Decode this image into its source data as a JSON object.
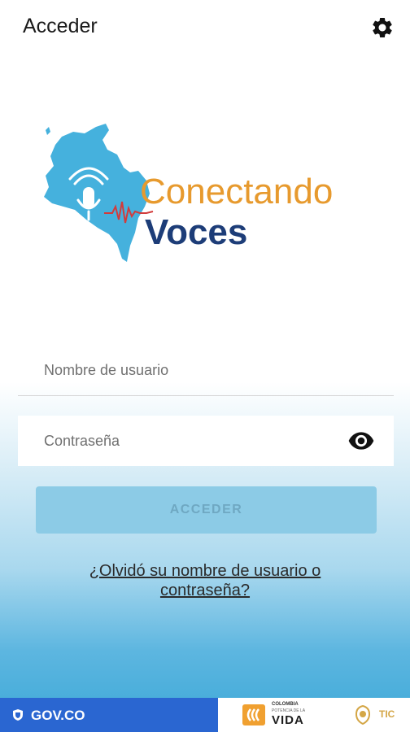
{
  "header": {
    "title": "Acceder",
    "settings_icon": "gear-icon"
  },
  "logo": {
    "line1": "Conectando",
    "line2": "Voces",
    "color_primary": "#e79a2e",
    "color_secondary": "#1d3d78",
    "map_color": "#45b1dd"
  },
  "form": {
    "username_placeholder": "Nombre de usuario",
    "password_placeholder": "Contraseña",
    "show_password_icon": "eye-icon",
    "submit_label": "ACCEDER",
    "forgot_link_line1": "¿Olvidó su nombre de usuario o",
    "forgot_link_line2": "contraseña?"
  },
  "footer": {
    "gov_label": "GOV.CO",
    "partner1_line1": "COLOMBIA",
    "partner1_line2": "POTENCIA DE LA",
    "partner1_line3": "VIDA",
    "partner2_label": "TIC",
    "gov_color": "#2a66d1"
  }
}
